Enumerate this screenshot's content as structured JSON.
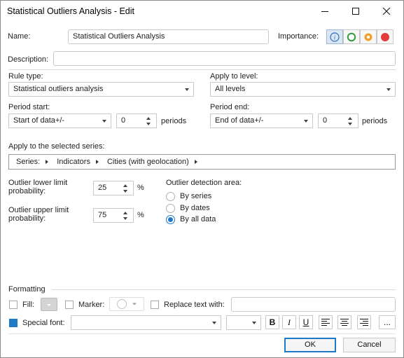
{
  "window": {
    "title": "Statistical Outliers Analysis - Edit"
  },
  "name": {
    "label": "Name:",
    "value": "Statistical Outliers Analysis"
  },
  "importance": {
    "label": "Importance:",
    "options": [
      "info",
      "green",
      "orange",
      "red"
    ],
    "colors": {
      "info": "#2a6ebd",
      "green": "#2e9e3a",
      "orange": "#f0a028",
      "red": "#e43c3c"
    }
  },
  "description": {
    "label": "Description:",
    "value": ""
  },
  "rule_type": {
    "label": "Rule type:",
    "value": "Statistical outliers analysis"
  },
  "apply_level": {
    "label": "Apply to level:",
    "value": "All levels"
  },
  "period_start": {
    "label": "Period start:",
    "value": "Start of data+/-",
    "offset": "0",
    "unit": "periods"
  },
  "period_end": {
    "label": "Period end:",
    "value": "End of data+/-",
    "offset": "0",
    "unit": "periods"
  },
  "series": {
    "label": "Apply to the selected series:",
    "crumbs": [
      "Series:",
      "Indicators",
      "Cities (with geolocation)"
    ]
  },
  "outlier_lower": {
    "label_line1": "Outlier lower limit",
    "label_line2": "probability:",
    "value": "25",
    "unit": "%"
  },
  "outlier_upper": {
    "label_line1": "Outlier upper limit",
    "label_line2": "probability:",
    "value": "75",
    "unit": "%"
  },
  "detection_area": {
    "label": "Outlier detection area:",
    "options": [
      "By series",
      "By dates",
      "By all data"
    ],
    "selected": "By all data"
  },
  "formatting": {
    "label": "Formatting",
    "fill_label": "Fill:",
    "marker_label": "Marker:",
    "replace_label": "Replace text with:",
    "replace_value": "",
    "special_font_label": "Special font:",
    "special_font_checked": true,
    "font_name": "",
    "font_size": "",
    "bold": "B",
    "italic": "I",
    "underline": "U",
    "more": "..."
  },
  "buttons": {
    "ok": "OK",
    "cancel": "Cancel"
  }
}
